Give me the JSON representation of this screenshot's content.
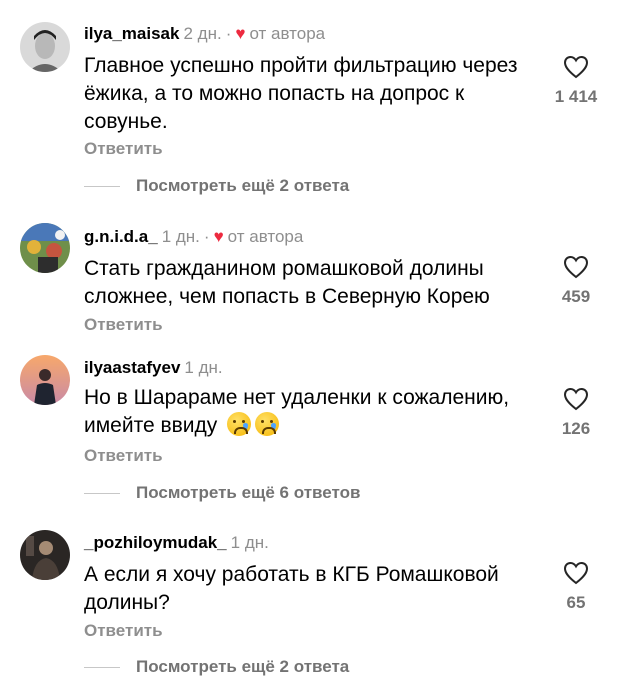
{
  "comments": [
    {
      "username": "ilya_maisak",
      "time": "2 дн.",
      "author_liked": true,
      "author_label": "от автора",
      "text": "Главное успешно пройти фильтрацию через ёжика, а то можно попасть на допрос к совунье.",
      "reply_label": "Ответить",
      "likes": "1 414",
      "more_replies": "Посмотреть ещё 2 ответа"
    },
    {
      "username": "g.n.i.d.a_",
      "time": "1 дн.",
      "author_liked": true,
      "author_label": "от автора",
      "text": "Стать гражданином ромашковой долины сложнее, чем попасть в Северную Корею",
      "reply_label": "Ответить",
      "likes": "459",
      "more_replies": ""
    },
    {
      "username": "ilyaastafyev",
      "time": "1 дн.",
      "author_liked": false,
      "author_label": "",
      "text": "Но в Шарараме нет удаленки к сожалению, имейте ввиду",
      "emoji": [
        "crying-face-emoji",
        "crying-face-emoji"
      ],
      "reply_label": "Ответить",
      "likes": "126",
      "more_replies": "Посмотреть ещё 6 ответов"
    },
    {
      "username": "_pozhiloymudak_",
      "time": "1 дн.",
      "author_liked": false,
      "author_label": "",
      "text": "А если я хочу работать в КГБ Ромашковой долины?",
      "reply_label": "Ответить",
      "likes": "65",
      "more_replies": "Посмотреть ещё 2 ответа"
    }
  ],
  "colors": {
    "heart_accent": "#ed2a3f",
    "muted_text": "#8e8e8e",
    "like_count": "#737373"
  },
  "icons": {
    "like": "heart-outline-icon",
    "author_like": "heart-filled-icon"
  }
}
